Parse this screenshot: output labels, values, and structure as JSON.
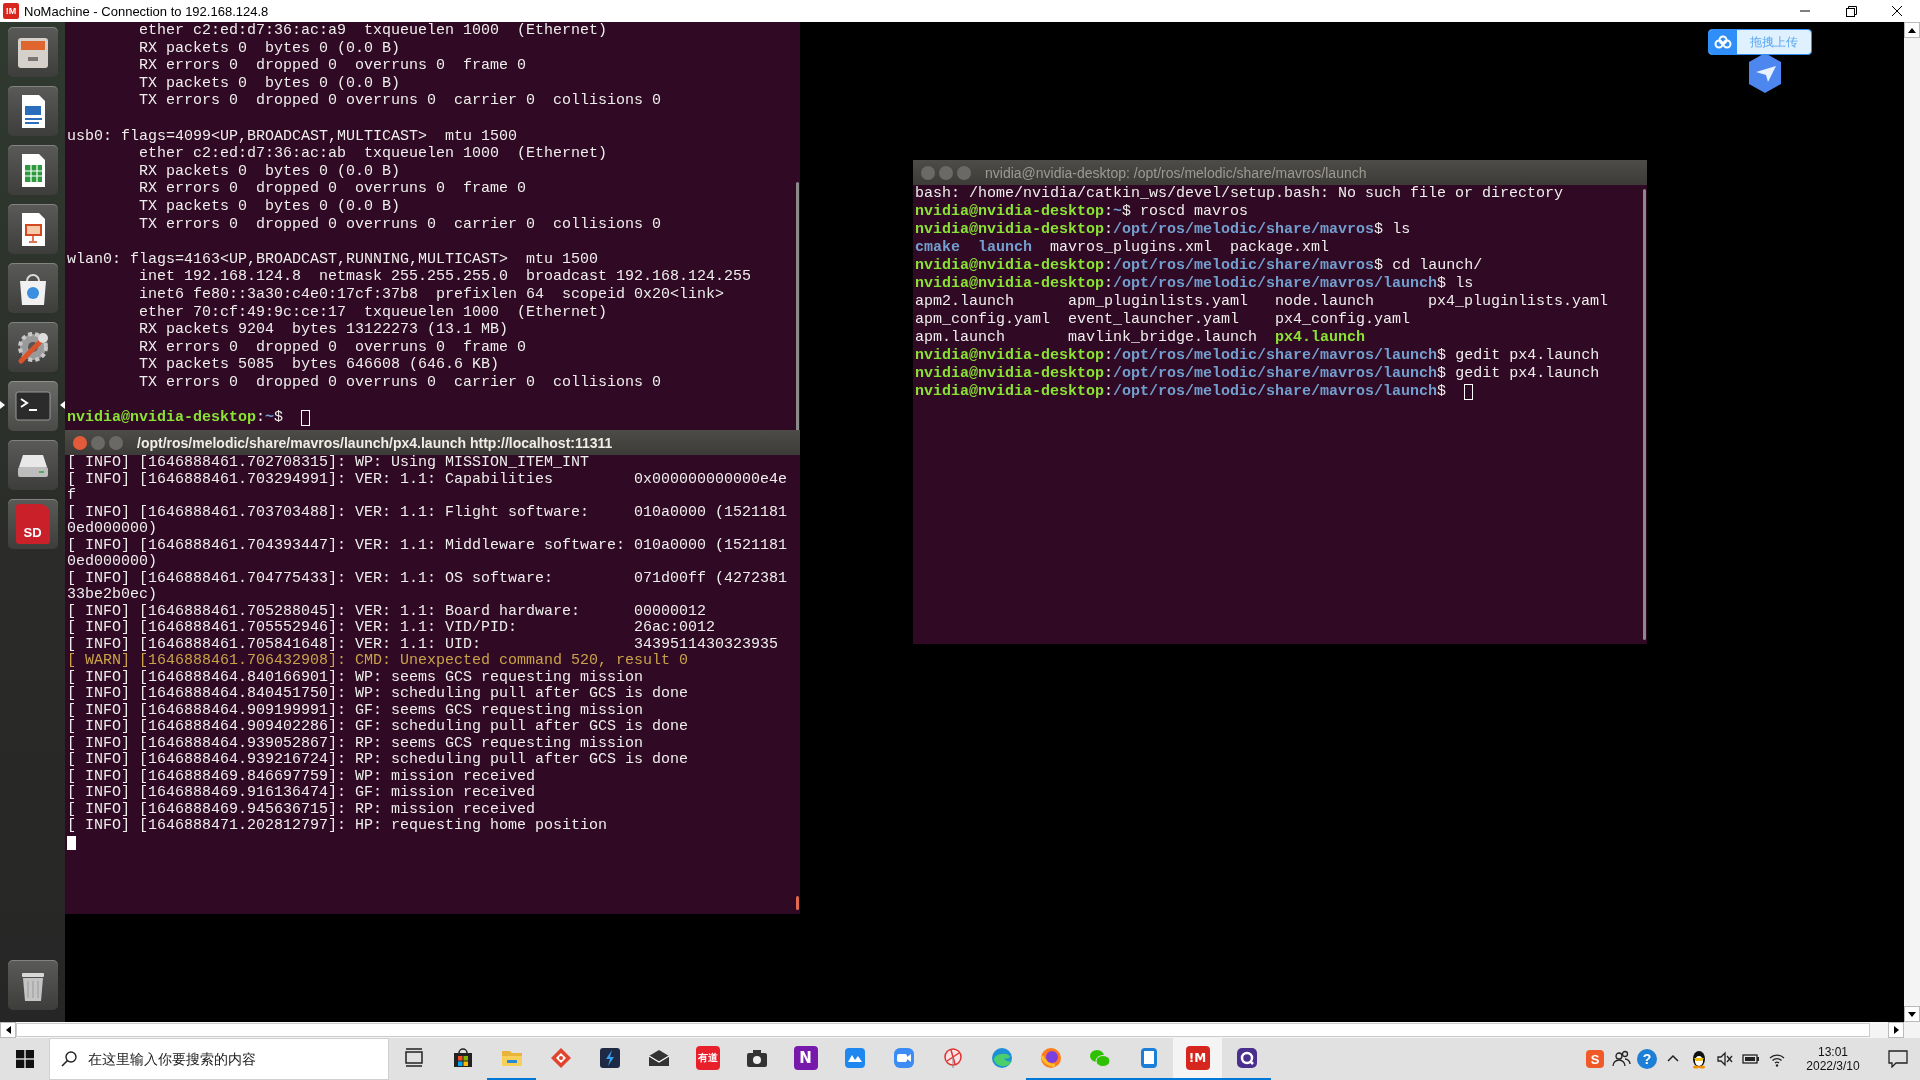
{
  "window": {
    "logo": "!M",
    "title": "NoMachine - Connection to 192.168.124.8"
  },
  "launcher": {
    "items": [
      {
        "kind": "files",
        "active": false
      },
      {
        "kind": "writer",
        "active": false
      },
      {
        "kind": "calc",
        "active": false
      },
      {
        "kind": "impress",
        "active": false
      },
      {
        "kind": "software",
        "active": false
      },
      {
        "kind": "settings",
        "active": false
      },
      {
        "kind": "terminal",
        "active": true
      },
      {
        "kind": "drive",
        "active": false
      },
      {
        "kind": "sd-card",
        "label": "SD",
        "active": false
      },
      {
        "kind": "trash",
        "active": false
      }
    ]
  },
  "terminals": [
    {
      "active": false,
      "lines": [
        {
          "kind": "text",
          "text": "        ether c2:ed:d7:36:ac:a9  txqueuelen 1000  (Ethernet)"
        },
        {
          "kind": "text",
          "text": "        RX packets 0  bytes 0 (0.0 B)"
        },
        {
          "kind": "text",
          "text": "        RX errors 0  dropped 0  overruns 0  frame 0"
        },
        {
          "kind": "text",
          "text": "        TX packets 0  bytes 0 (0.0 B)"
        },
        {
          "kind": "text",
          "text": "        TX errors 0  dropped 0 overruns 0  carrier 0  collisions 0"
        },
        {
          "kind": "blank"
        },
        {
          "kind": "text",
          "text": "usb0: flags=4099<UP,BROADCAST,MULTICAST>  mtu 1500"
        },
        {
          "kind": "text",
          "text": "        ether c2:ed:d7:36:ac:ab  txqueuelen 1000  (Ethernet)"
        },
        {
          "kind": "text",
          "text": "        RX packets 0  bytes 0 (0.0 B)"
        },
        {
          "kind": "text",
          "text": "        RX errors 0  dropped 0  overruns 0  frame 0"
        },
        {
          "kind": "text",
          "text": "        TX packets 0  bytes 0 (0.0 B)"
        },
        {
          "kind": "text",
          "text": "        TX errors 0  dropped 0 overruns 0  carrier 0  collisions 0"
        },
        {
          "kind": "blank"
        },
        {
          "kind": "text",
          "text": "wlan0: flags=4163<UP,BROADCAST,RUNNING,MULTICAST>  mtu 1500"
        },
        {
          "kind": "text",
          "text": "        inet 192.168.124.8  netmask 255.255.255.0  broadcast 192.168.124.255"
        },
        {
          "kind": "text",
          "text": "        inet6 fe80::3a30:c4e0:17cf:37b8  prefixlen 64  scopeid 0x20<link>"
        },
        {
          "kind": "text",
          "text": "        ether 70:cf:49:9c:ce:17  txqueuelen 1000  (Ethernet)"
        },
        {
          "kind": "text",
          "text": "        RX packets 9204  bytes 13122273 (13.1 MB)"
        },
        {
          "kind": "text",
          "text": "        RX errors 0  dropped 0  overruns 0  frame 0"
        },
        {
          "kind": "text",
          "text": "        TX packets 5085  bytes 646608 (646.6 KB)"
        },
        {
          "kind": "text",
          "text": "        TX errors 0  dropped 0 overruns 0  carrier 0  collisions 0"
        },
        {
          "kind": "blank"
        },
        {
          "kind": "prompt",
          "host": "nvidia@nvidia-desktop",
          "sep": ":",
          "path": "~",
          "dollar": "$",
          "cursor": true
        }
      ]
    },
    {
      "active": true,
      "title": "/opt/ros/melodic/share/mavros/launch/px4.launch http://localhost:11311",
      "lines": [
        {
          "kind": "text",
          "text": "[ INFO] [1646888461.702708315]: WP: Using MISSION_ITEM_INT"
        },
        {
          "kind": "text",
          "text": "[ INFO] [1646888461.703294991]: VER: 1.1: Capabilities         0x000000000000e4e"
        },
        {
          "kind": "text",
          "text": "f"
        },
        {
          "kind": "text",
          "text": "[ INFO] [1646888461.703703488]: VER: 1.1: Flight software:     010a0000 (1521181"
        },
        {
          "kind": "text",
          "text": "0ed000000)"
        },
        {
          "kind": "text",
          "text": "[ INFO] [1646888461.704393447]: VER: 1.1: Middleware software: 010a0000 (1521181"
        },
        {
          "kind": "text",
          "text": "0ed000000)"
        },
        {
          "kind": "text",
          "text": "[ INFO] [1646888461.704775433]: VER: 1.1: OS software:         071d00ff (4272381"
        },
        {
          "kind": "text",
          "text": "33be2b0ec)"
        },
        {
          "kind": "text",
          "text": "[ INFO] [1646888461.705288045]: VER: 1.1: Board hardware:      00000012"
        },
        {
          "kind": "text",
          "text": "[ INFO] [1646888461.705552946]: VER: 1.1: VID/PID:             26ac:0012"
        },
        {
          "kind": "text",
          "text": "[ INFO] [1646888461.705841648]: VER: 1.1: UID:                 3439511430323935"
        },
        {
          "kind": "warn",
          "text": "[ WARN] [1646888461.706432908]: CMD: Unexpected command 520, result 0"
        },
        {
          "kind": "text",
          "text": "[ INFO] [1646888464.840166901]: WP: seems GCS requesting mission"
        },
        {
          "kind": "text",
          "text": "[ INFO] [1646888464.840451750]: WP: scheduling pull after GCS is done"
        },
        {
          "kind": "text",
          "text": "[ INFO] [1646888464.909199991]: GF: seems GCS requesting mission"
        },
        {
          "kind": "text",
          "text": "[ INFO] [1646888464.909402286]: GF: scheduling pull after GCS is done"
        },
        {
          "kind": "text",
          "text": "[ INFO] [1646888464.939052867]: RP: seems GCS requesting mission"
        },
        {
          "kind": "text",
          "text": "[ INFO] [1646888464.939216724]: RP: scheduling pull after GCS is done"
        },
        {
          "kind": "text",
          "text": "[ INFO] [1646888469.846697759]: WP: mission received"
        },
        {
          "kind": "text",
          "text": "[ INFO] [1646888469.916136474]: GF: mission received"
        },
        {
          "kind": "text",
          "text": "[ INFO] [1646888469.945636715]: RP: mission received"
        },
        {
          "kind": "text",
          "text": "[ INFO] [1646888471.202812797]: HP: requesting home position"
        },
        {
          "kind": "cursor"
        }
      ]
    },
    {
      "active": false,
      "title": "nvidia@nvidia-desktop: /opt/ros/melodic/share/mavros/launch",
      "lines": [
        {
          "kind": "text",
          "text": "bash: /home/nvidia/catkin_ws/devel/setup.bash: No such file or directory"
        },
        {
          "kind": "prompt",
          "host": "nvidia@nvidia-desktop",
          "sep": ":",
          "path": "~",
          "dollar": "$",
          "command": "roscd mavros",
          "cursor": false
        },
        {
          "kind": "prompt",
          "host": "nvidia@nvidia-desktop",
          "sep": ":",
          "path": "/opt/ros/melodic/share/mavros",
          "dollar": "$",
          "command": "ls",
          "cursor": false
        },
        {
          "kind": "ls",
          "rows": [
            [
              {
                "text": "cmake",
                "kind": "dir"
              },
              {
                "text": "launch",
                "kind": "dir"
              },
              {
                "text": "mavros_plugins.xml",
                "kind": "file"
              },
              {
                "text": "package.xml",
                "kind": "file"
              }
            ]
          ]
        },
        {
          "kind": "prompt",
          "host": "nvidia@nvidia-desktop",
          "sep": ":",
          "path": "/opt/ros/melodic/share/mavros",
          "dollar": "$",
          "command": "cd launch/",
          "cursor": false
        },
        {
          "kind": "prompt",
          "host": "nvidia@nvidia-desktop",
          "sep": ":",
          "path": "/opt/ros/melodic/share/mavros/launch",
          "dollar": "$",
          "command": "ls",
          "cursor": false
        },
        {
          "kind": "ls",
          "rows": [
            [
              {
                "text": "apm2.launch",
                "kind": "file"
              },
              {
                "text": "apm_pluginlists.yaml",
                "kind": "file"
              },
              {
                "text": "node.launch",
                "kind": "file"
              },
              {
                "text": "px4_pluginlists.yaml",
                "kind": "file"
              }
            ],
            [
              {
                "text": "apm_config.yaml",
                "kind": "file"
              },
              {
                "text": "event_launcher.yaml",
                "kind": "file"
              },
              {
                "text": "px4_config.yaml",
                "kind": "file"
              }
            ],
            [
              {
                "text": "apm.launch",
                "kind": "file"
              },
              {
                "text": "mavlink_bridge.launch",
                "kind": "file"
              },
              {
                "text": "px4.launch",
                "kind": "exec"
              }
            ]
          ]
        },
        {
          "kind": "prompt",
          "host": "nvidia@nvidia-desktop",
          "sep": ":",
          "path": "/opt/ros/melodic/share/mavros/launch",
          "dollar": "$",
          "command": "gedit px4.launch",
          "cursor": false
        },
        {
          "kind": "prompt",
          "host": "nvidia@nvidia-desktop",
          "sep": ":",
          "path": "/opt/ros/melodic/share/mavros/launch",
          "dollar": "$",
          "command": "gedit px4.launch",
          "cursor": false
        },
        {
          "kind": "prompt",
          "host": "nvidia@nvidia-desktop",
          "sep": ":",
          "path": "/opt/ros/melodic/share/mavros/launch",
          "dollar": "$",
          "cursor": true
        }
      ]
    }
  ],
  "upload_widget": {
    "label": "拖拽上传"
  },
  "taskbar": {
    "search": {
      "placeholder": "在这里输入你要搜索的内容"
    },
    "apps": [
      {
        "kind": "taskview",
        "running": false,
        "selected": false
      },
      {
        "kind": "store",
        "running": false,
        "selected": false
      },
      {
        "kind": "explorer",
        "running": true,
        "selected": false
      },
      {
        "kind": "diamond",
        "running": false,
        "selected": false
      },
      {
        "kind": "lightning",
        "running": false,
        "selected": false
      },
      {
        "kind": "mail",
        "running": false,
        "selected": false
      },
      {
        "kind": "youdao",
        "label": "有道",
        "running": false,
        "selected": false
      },
      {
        "kind": "camera",
        "running": false,
        "selected": false
      },
      {
        "kind": "onenote",
        "label": "N",
        "running": false,
        "selected": false
      },
      {
        "kind": "cloud",
        "running": false,
        "selected": false
      },
      {
        "kind": "zoom",
        "running": false,
        "selected": false
      },
      {
        "kind": "pinwheel",
        "running": false,
        "selected": false
      },
      {
        "kind": "edge",
        "running": false,
        "selected": false
      },
      {
        "kind": "firefox",
        "running": true,
        "selected": false
      },
      {
        "kind": "wechat",
        "running": true,
        "selected": false
      },
      {
        "kind": "phone",
        "running": true,
        "selected": false
      },
      {
        "kind": "nomachine",
        "label": "!M",
        "running": true,
        "selected": true
      },
      {
        "kind": "qapp",
        "running": true,
        "selected": false
      }
    ],
    "tray": [
      {
        "kind": "sogou",
        "label": "S"
      },
      {
        "kind": "people"
      },
      {
        "kind": "help",
        "label": "?"
      },
      {
        "kind": "caret"
      },
      {
        "kind": "penguin"
      },
      {
        "kind": "muted"
      },
      {
        "kind": "battery"
      },
      {
        "kind": "wifi"
      }
    ],
    "clock": {
      "time": "13:01",
      "date": "2022/3/10"
    }
  }
}
